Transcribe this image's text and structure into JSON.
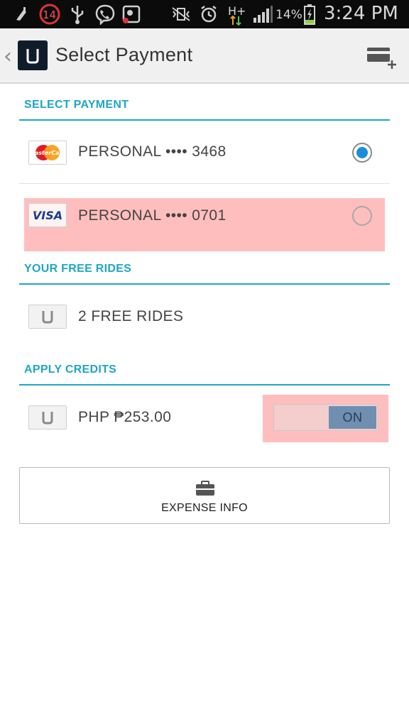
{
  "status_bar": {
    "notification_count": "14",
    "network_type": "H+",
    "battery_percent": "14%",
    "time": "3:24 PM"
  },
  "header": {
    "title": "Select Payment",
    "back_icon": "chevron-left-icon",
    "add_card_icon": "add-card-icon"
  },
  "payment": {
    "section_title": "SELECT PAYMENT",
    "methods": [
      {
        "brand": "MasterCard",
        "label": "PERSONAL •••• 3468",
        "selected": true
      },
      {
        "brand": "VISA",
        "label": "PERSONAL •••• 0701",
        "selected": false
      }
    ]
  },
  "free_rides": {
    "section_title": "YOUR FREE RIDES",
    "label": "2 FREE RIDES"
  },
  "credits": {
    "section_title": "APPLY CREDITS",
    "label": "PHP ₱253.00",
    "toggle_label": "ON",
    "toggle_on": true
  },
  "expense": {
    "label": "EXPENSE INFO",
    "icon": "briefcase-icon"
  },
  "colors": {
    "accent": "#1fa6c4",
    "radio_selected": "#1a8fd6",
    "highlight": "#ff9696"
  }
}
